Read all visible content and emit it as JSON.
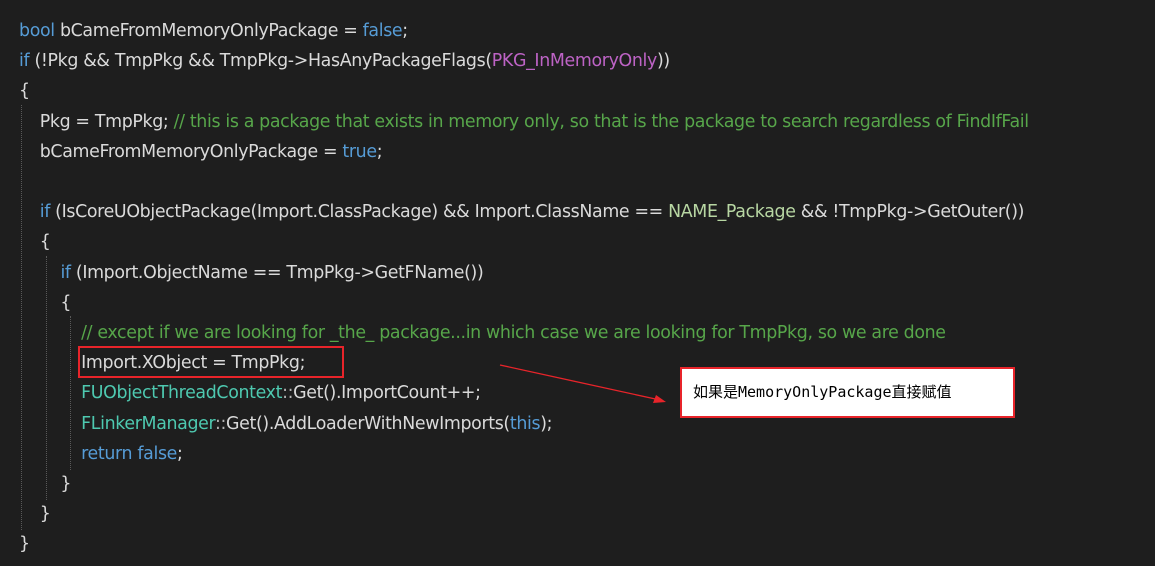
{
  "code_lines": [
    [
      {
        "t": "bool",
        "c": "kw"
      },
      {
        "t": " bCameFromMemoryOnlyPackage = ",
        "c": "id"
      },
      {
        "t": "false",
        "c": "kw"
      },
      {
        "t": ";",
        "c": "id"
      }
    ],
    [
      {
        "t": "if",
        "c": "kw"
      },
      {
        "t": " (!Pkg && TmpPkg && TmpPkg->HasAnyPackageFlags(",
        "c": "id"
      },
      {
        "t": "PKG_InMemoryOnly",
        "c": "mac2"
      },
      {
        "t": "))",
        "c": "id"
      }
    ],
    [
      {
        "t": "{",
        "c": "id"
      }
    ],
    [
      {
        "t": "    Pkg = TmpPkg; ",
        "c": "id"
      },
      {
        "t": "// this is a package that exists in memory only, so that is the package to search regardless of FindIfFail",
        "c": "cm"
      }
    ],
    [
      {
        "t": "    bCameFromMemoryOnlyPackage = ",
        "c": "id"
      },
      {
        "t": "true",
        "c": "kw"
      },
      {
        "t": ";",
        "c": "id"
      }
    ],
    [],
    [
      {
        "t": "    ",
        "c": "id"
      },
      {
        "t": "if",
        "c": "kw"
      },
      {
        "t": " (IsCoreUObjectPackage(Import.ClassPackage) && Import.ClassName == ",
        "c": "id"
      },
      {
        "t": "NAME_Package",
        "c": "nm"
      },
      {
        "t": " && !TmpPkg->GetOuter())",
        "c": "id"
      }
    ],
    [
      {
        "t": "    {",
        "c": "id"
      }
    ],
    [
      {
        "t": "        ",
        "c": "id"
      },
      {
        "t": "if",
        "c": "kw"
      },
      {
        "t": " (Import.ObjectName == TmpPkg->GetFName())",
        "c": "id"
      }
    ],
    [
      {
        "t": "        {",
        "c": "id"
      }
    ],
    [
      {
        "t": "            ",
        "c": "id"
      },
      {
        "t": "// except if we are looking for _the_ package...in which case we are looking for TmpPkg, so we are done",
        "c": "cm"
      }
    ],
    [
      {
        "t": "            Import.XObject = TmpPkg;",
        "c": "id"
      }
    ],
    [
      {
        "t": "            ",
        "c": "id"
      },
      {
        "t": "FUObjectThreadContext",
        "c": "type"
      },
      {
        "t": "::",
        "c": "op"
      },
      {
        "t": "Get().ImportCount++;",
        "c": "id"
      }
    ],
    [
      {
        "t": "            ",
        "c": "id"
      },
      {
        "t": "FLinkerManager",
        "c": "type"
      },
      {
        "t": "::",
        "c": "op"
      },
      {
        "t": "Get().AddLoaderWithNewImports(",
        "c": "id"
      },
      {
        "t": "this",
        "c": "kw"
      },
      {
        "t": ");",
        "c": "id"
      }
    ],
    [
      {
        "t": "            ",
        "c": "id"
      },
      {
        "t": "return",
        "c": "kw"
      },
      {
        "t": " ",
        "c": "id"
      },
      {
        "t": "false",
        "c": "kw"
      },
      {
        "t": ";",
        "c": "id"
      }
    ],
    [
      {
        "t": "        }",
        "c": "id"
      }
    ],
    [
      {
        "t": "    }",
        "c": "id"
      }
    ],
    [
      {
        "t": "}",
        "c": "id"
      }
    ]
  ],
  "annotation": {
    "callout_text": "如果是MemoryOnlyPackage直接赋值",
    "highlighted_line_index": 11
  },
  "colors": {
    "background": "#1e1e1e",
    "keyword": "#569cd6",
    "identifier": "#dadada",
    "comment": "#57a64a",
    "macro": "#bd63c5",
    "type": "#4ec9b0",
    "name_constant": "#b8d7a3",
    "annotation_red": "#e8242a"
  }
}
